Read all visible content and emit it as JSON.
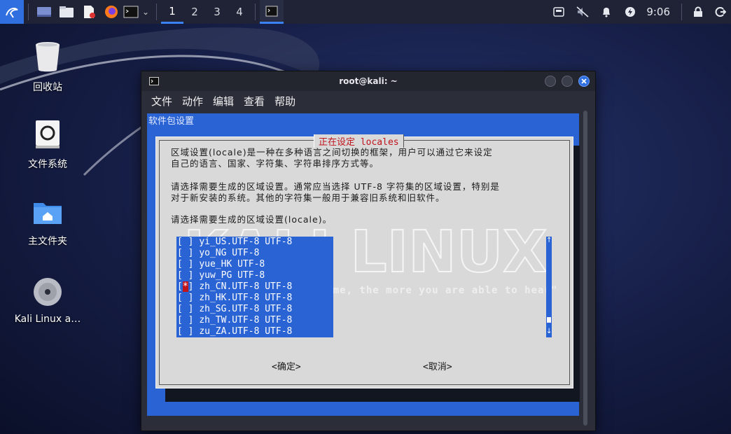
{
  "panel": {
    "workspaces": [
      "1",
      "2",
      "3",
      "4"
    ],
    "clock": "9:06"
  },
  "desktop": {
    "icons": [
      {
        "label": "回收站"
      },
      {
        "label": "文件系统"
      },
      {
        "label": "主文件夹"
      },
      {
        "label": "Kali Linux a…"
      }
    ]
  },
  "window": {
    "title": "root@kali: ~",
    "menu": [
      "文件",
      "动作",
      "编辑",
      "查看",
      "帮助"
    ],
    "terminal_header": "软件包设置",
    "dialog": {
      "title": "正在设定 locales",
      "para1": [
        "区域设置(locale)是一种在多种语言之间切换的框架，用户可以通过它来设定",
        "自己的语言、国家、字符集、字符串排序方式等。"
      ],
      "para2": [
        "请选择需要生成的区域设置。通常应当选择 UTF-8 字符集的区域设置，特别是",
        "对于新安装的系统。其他的字符集一般用于兼容旧系统和旧软件。"
      ],
      "para3": "请选择需要生成的区域设置(locale)。",
      "items": [
        {
          "check": "[ ]",
          "label": "yi_US.UTF-8 UTF-8"
        },
        {
          "check": "[ ]",
          "label": "yo_NG UTF-8"
        },
        {
          "check": "[ ]",
          "label": "yue_HK UTF-8"
        },
        {
          "check": "[ ]",
          "label": "yuw_PG UTF-8"
        },
        {
          "check": "[*]",
          "label": "zh_CN.UTF-8 UTF-8"
        },
        {
          "check": "[ ]",
          "label": "zh_HK.UTF-8 UTF-8"
        },
        {
          "check": "[ ]",
          "label": "zh_SG.UTF-8 UTF-8"
        },
        {
          "check": "[ ]",
          "label": "zh_TW.UTF-8 UTF-8"
        },
        {
          "check": "[ ]",
          "label": "zu_ZA.UTF-8 UTF-8"
        }
      ],
      "ok_label": "<确定>",
      "cancel_label": "<取消>",
      "watermark": "KALI LINUX",
      "tagline": "become, the more you are able to hear\""
    }
  },
  "colors": {
    "accent": "#3b82f6",
    "terminal_bg": "#2a63d4",
    "dialog_bg": "#d9d9d9",
    "dialog_title": "#c0141c"
  }
}
